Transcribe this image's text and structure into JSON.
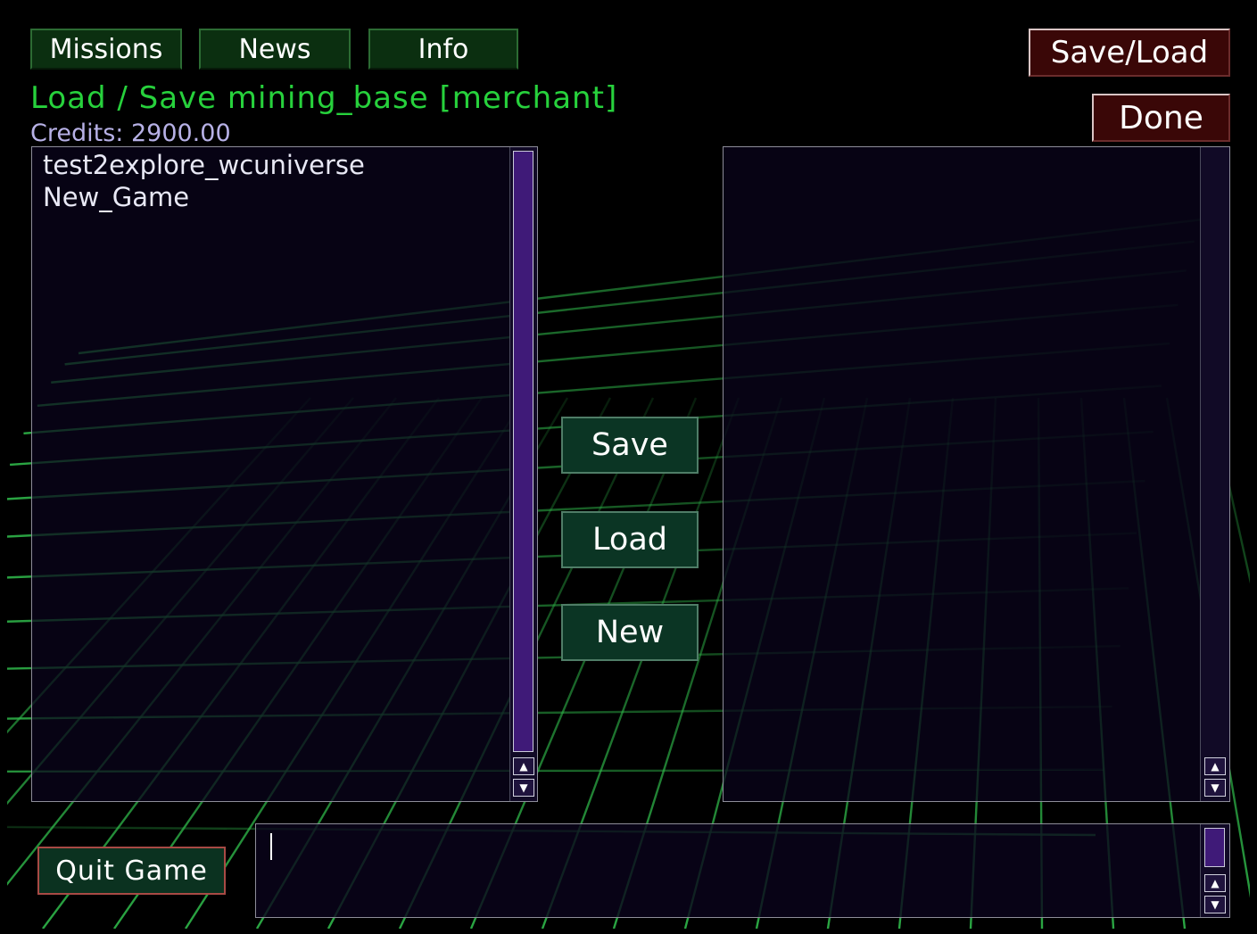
{
  "tabs": [
    {
      "label": "Missions"
    },
    {
      "label": "News"
    },
    {
      "label": "Info"
    }
  ],
  "header": {
    "title": "Load / Save mining_base [merchant]",
    "credits_label": "Credits:",
    "credits_value": "2900.00"
  },
  "top_right": {
    "save_load_label": "Save/Load",
    "done_label": "Done"
  },
  "saves_list": {
    "items": [
      "test2explore_wcuniverse",
      "New_Game"
    ]
  },
  "actions": {
    "save_label": "Save",
    "load_label": "Load",
    "new_label": "New"
  },
  "footer": {
    "quit_label": "Quit Game",
    "input_value": ""
  },
  "colors": {
    "accent_green": "#27d13c",
    "credits_text": "#b7b1e6",
    "tab_bg": "#0b2f10",
    "red_button_bg": "#3a0707",
    "panel_bg": "#0a041c",
    "grid_line": "#2fb84a",
    "scroll_thumb": "#3f1a78"
  },
  "icons": {
    "scroll_up": "up-arrow-icon",
    "scroll_down": "down-arrow-icon"
  }
}
